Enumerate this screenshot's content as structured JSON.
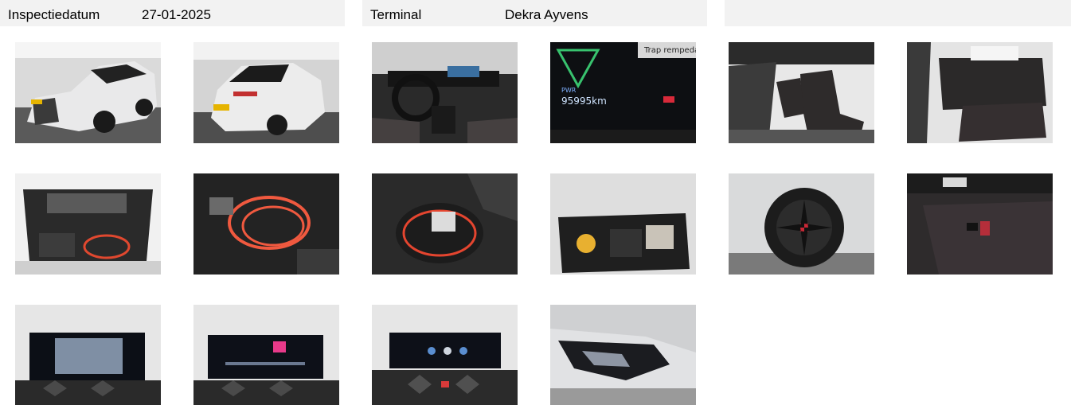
{
  "header": {
    "inspection_date_label": "Inspectiedatum",
    "inspection_date_value": "27-01-2025",
    "terminal_label": "Terminal",
    "terminal_value": "Dekra Ayvens"
  },
  "dashboard_readout": {
    "odometer": "95995km",
    "mode": "PWR",
    "notice": "Trap rempedaal"
  },
  "photos": [
    {
      "name": "photo-front-left-exterior"
    },
    {
      "name": "photo-rear-right-exterior"
    },
    {
      "name": "photo-cockpit"
    },
    {
      "name": "photo-instrument-cluster"
    },
    {
      "name": "photo-front-seats"
    },
    {
      "name": "photo-rear-seats"
    },
    {
      "name": "photo-trunk-open"
    },
    {
      "name": "photo-charging-cables"
    },
    {
      "name": "photo-cable-bag"
    },
    {
      "name": "photo-repair-kit"
    },
    {
      "name": "photo-wheel-rim"
    },
    {
      "name": "photo-keys-on-seat"
    },
    {
      "name": "photo-navigation-screen"
    },
    {
      "name": "photo-media-screen"
    },
    {
      "name": "photo-climate-screen"
    },
    {
      "name": "photo-headlight"
    }
  ]
}
